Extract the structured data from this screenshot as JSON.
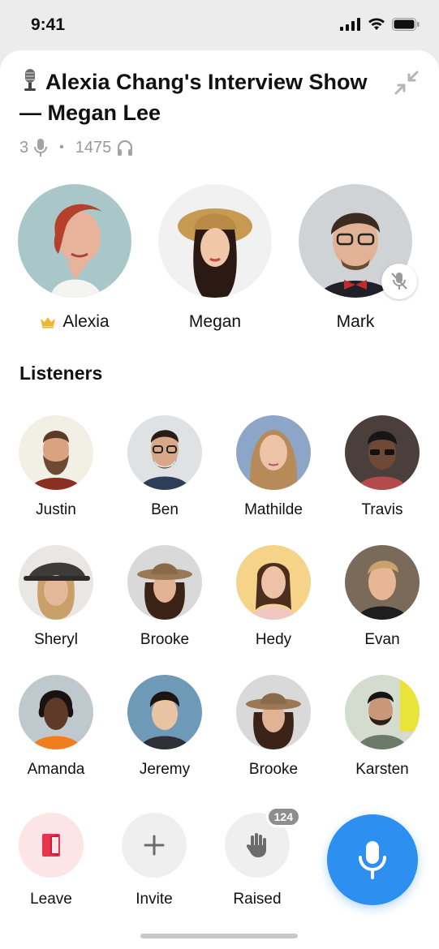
{
  "status_bar": {
    "time": "9:41",
    "icons": [
      "signal-icon",
      "wifi-icon",
      "battery-icon"
    ]
  },
  "room": {
    "title": "Alexia Chang's Interview Show — Megan Lee",
    "speaker_count": "3",
    "listener_count": "1475"
  },
  "speakers": [
    {
      "name": "Alexia",
      "role": "host",
      "muted": false
    },
    {
      "name": "Megan",
      "muted": false
    },
    {
      "name": "Mark",
      "muted": true
    }
  ],
  "listeners_section": {
    "title": "Listeners"
  },
  "listeners": [
    {
      "name": "Justin"
    },
    {
      "name": "Ben"
    },
    {
      "name": "Mathilde"
    },
    {
      "name": "Travis"
    },
    {
      "name": "Sheryl"
    },
    {
      "name": "Brooke"
    },
    {
      "name": "Hedy"
    },
    {
      "name": "Evan"
    },
    {
      "name": "Amanda"
    },
    {
      "name": "Jeremy"
    },
    {
      "name": "Brooke"
    },
    {
      "name": "Karsten"
    }
  ],
  "actions": {
    "leave": "Leave",
    "invite": "Invite",
    "raised": "Raised",
    "raised_count": "124"
  },
  "colors": {
    "accent": "#2d8ff0",
    "leave_bg": "#fde4e7",
    "leave_icon": "#e8354f",
    "crown": "#f3b62b"
  }
}
